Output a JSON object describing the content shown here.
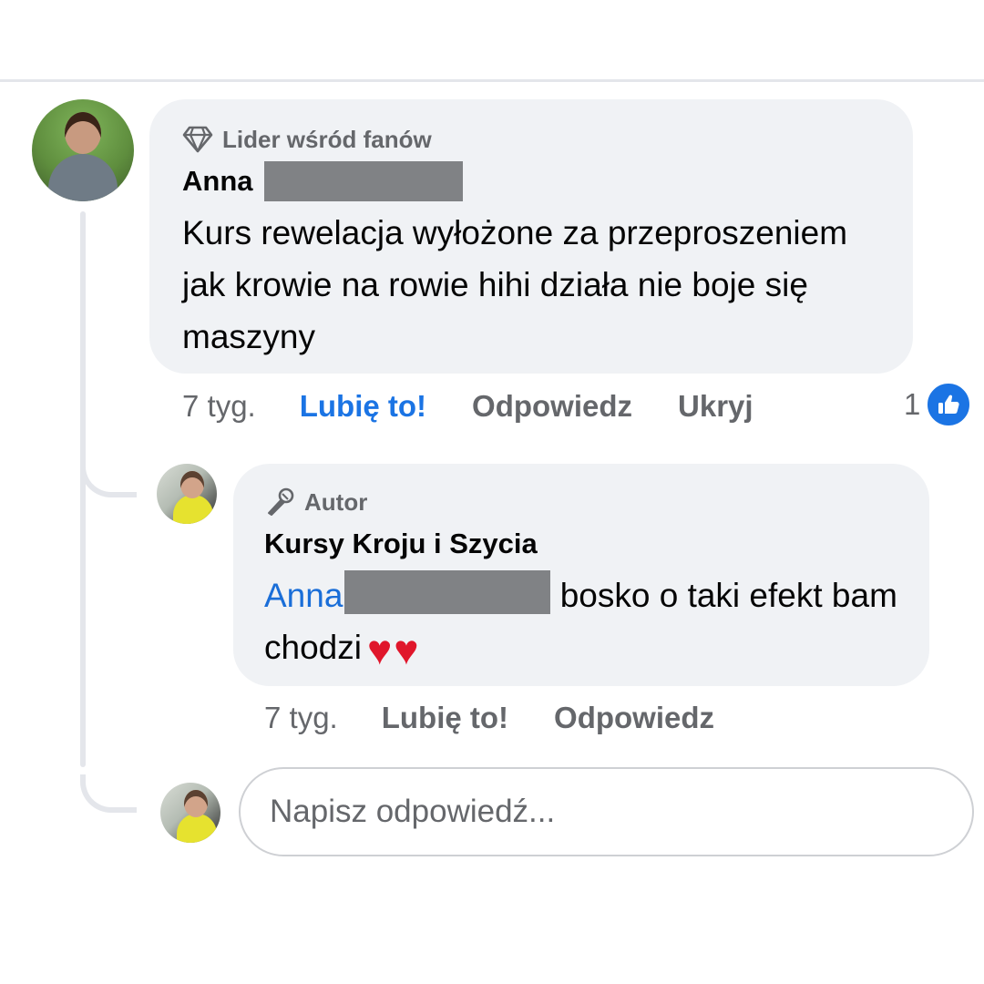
{
  "comments": [
    {
      "badge": "Lider wśród fanów",
      "author_first_name": "Anna",
      "text": "Kurs rewelacja wyłożone za przeproszeniem jak krowie na rowie hihi działa nie boje się maszyny",
      "time": "7 tyg.",
      "like_label": "Lubię to!",
      "reply_label": "Odpowiedz",
      "hide_label": "Ukryj",
      "reaction_count": "1"
    }
  ],
  "reply": {
    "badge": "Autor",
    "author": "Kursy Kroju i Szycia",
    "mention": "Anna",
    "text_after_mention": "bosko o taki efekt bam chodzi",
    "time": "7 tyg.",
    "like_label": "Lubię to!",
    "reply_label": "Odpowiedz"
  },
  "reply_box": {
    "placeholder": "Napisz odpowiedź..."
  },
  "icons": {
    "badge_fan": "diamond-icon",
    "badge_author": "microphone-icon",
    "reaction": "thumbs-up-icon",
    "emoji": "red-heart-icon"
  },
  "colors": {
    "bubble": "#f0f2f5",
    "secondary_text": "#65676b",
    "link_blue": "#1a6ed8",
    "like_blue": "#1b74e4",
    "heart_red": "#e0162b"
  }
}
